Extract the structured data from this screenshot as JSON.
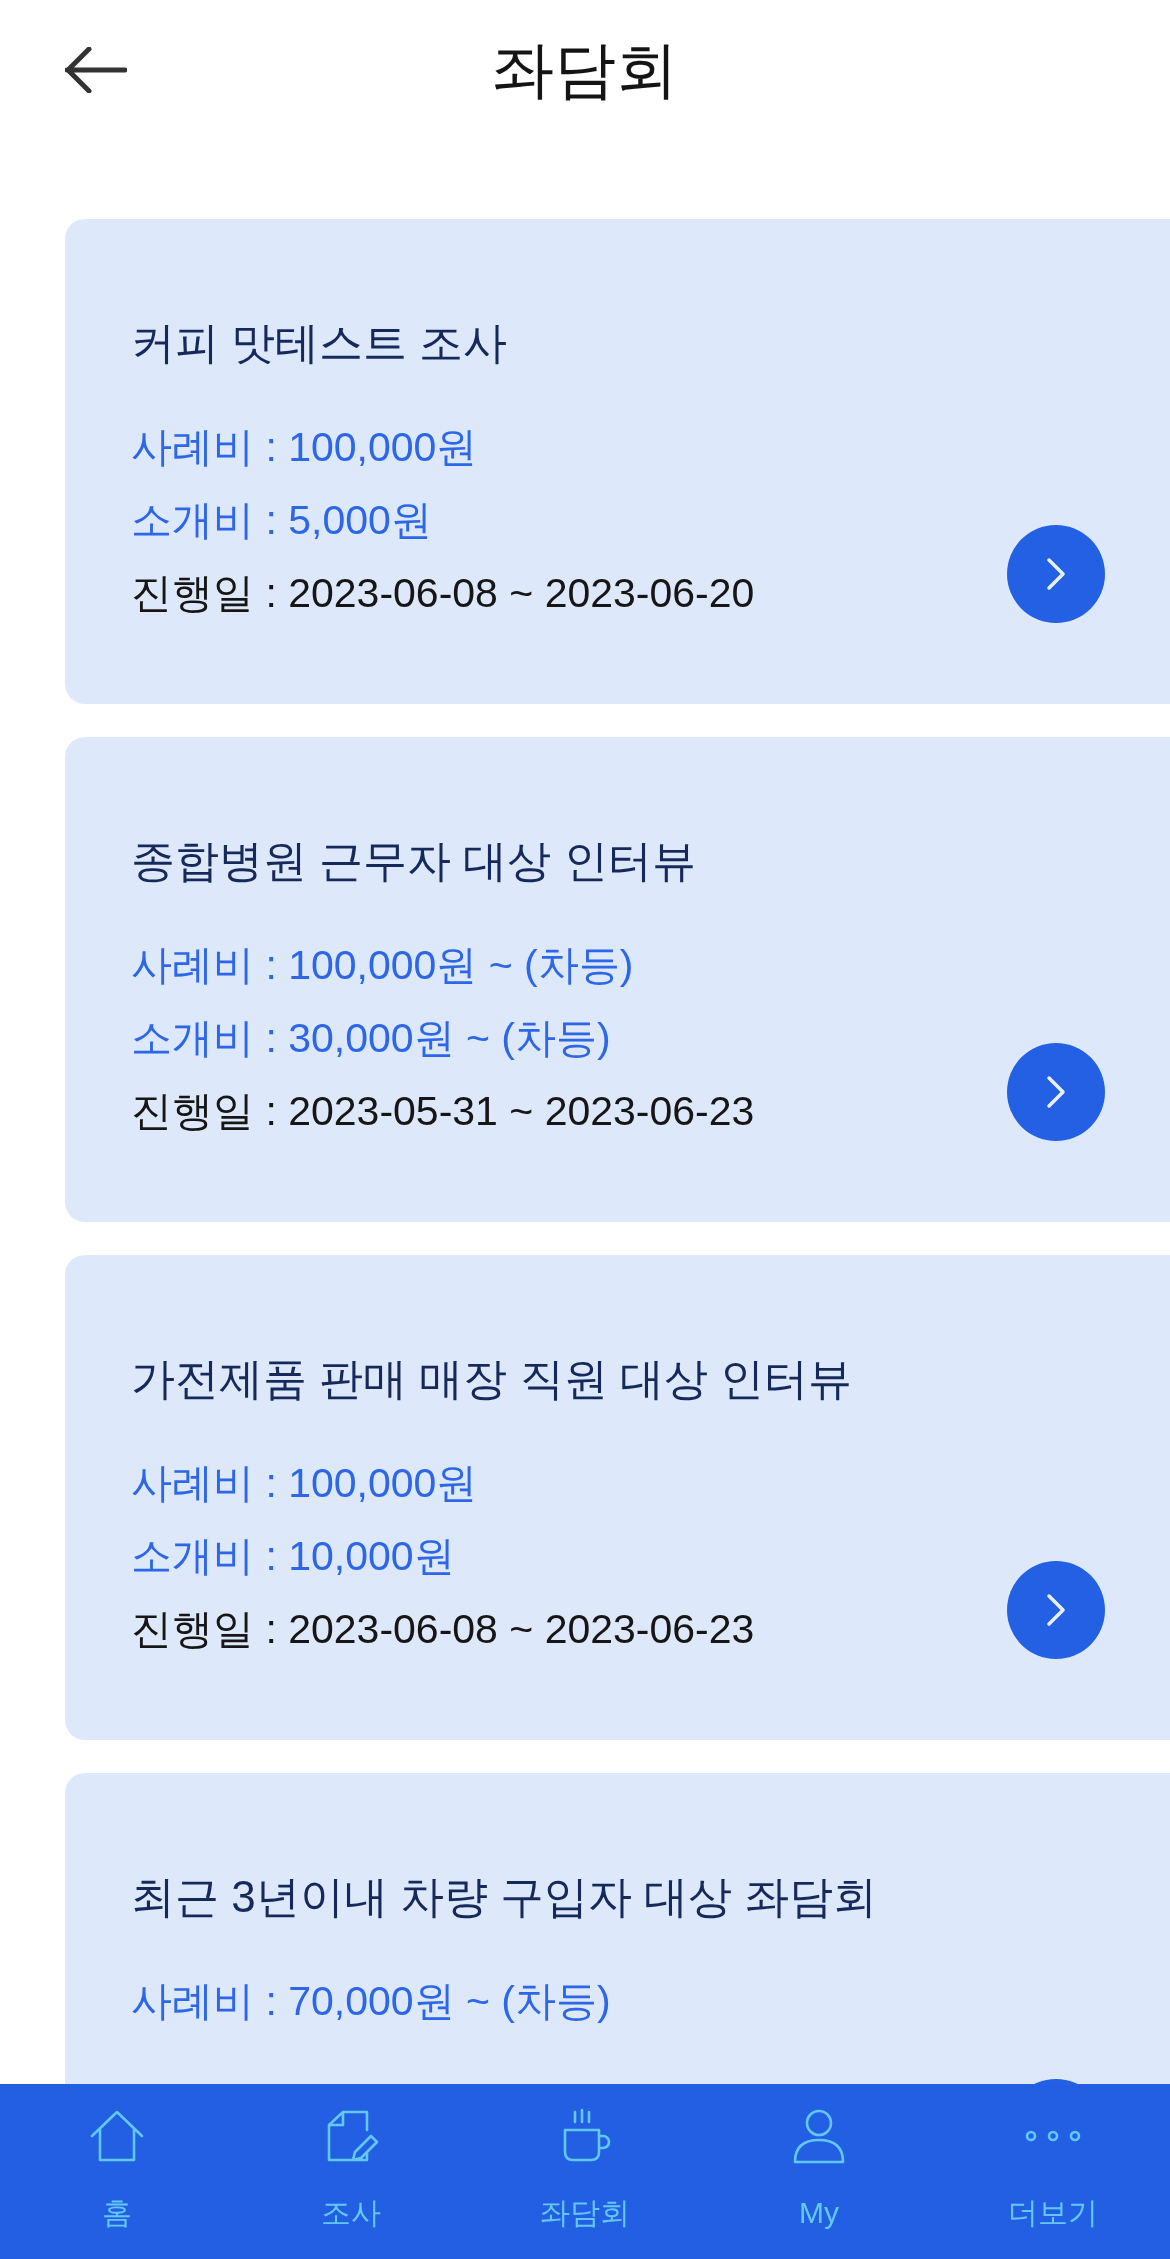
{
  "header": {
    "title": "좌담회"
  },
  "cards": [
    {
      "title": "커피 맛테스트 조사",
      "lines": [
        {
          "kind": "reward",
          "text": "사례비 : **100,000원**"
        },
        {
          "kind": "referral",
          "text": "소개비 : **5,000원**"
        },
        {
          "kind": "period",
          "text": "진행일 : **2023-06-08 ~ 2023-06-20**"
        }
      ]
    },
    {
      "title": "종합병원 근무자 대상 인터뷰",
      "lines": [
        {
          "kind": "reward",
          "text": "사례비 : **100,000원 ~ (차등)**"
        },
        {
          "kind": "referral",
          "text": "소개비 : **30,000원 ~ (차등)**"
        },
        {
          "kind": "period",
          "text": "진행일 : **2023-05-31 ~ 2023-06-23**"
        }
      ]
    },
    {
      "title": "가전제품 판매 매장 직원 대상 인터뷰",
      "lines": [
        {
          "kind": "reward",
          "text": "사례비 : **100,000원**"
        },
        {
          "kind": "referral",
          "text": "소개비 : **10,000원**"
        },
        {
          "kind": "period",
          "text": "진행일 : **2023-06-08 ~ 2023-06-23**"
        }
      ]
    },
    {
      "title": "최근 3년이내 차량 구입자 대상 좌담회",
      "lines": [
        {
          "kind": "reward",
          "text": "사례비 : **70,000원 ~ (차등)**"
        }
      ]
    }
  ],
  "bottom_nav": [
    {
      "kind": "home",
      "label": "홈"
    },
    {
      "kind": "survey",
      "label": "조사"
    },
    {
      "kind": "meeting",
      "label": "좌담회"
    },
    {
      "kind": "profile",
      "label": "My"
    },
    {
      "kind": "more",
      "label": "더보기"
    }
  ]
}
